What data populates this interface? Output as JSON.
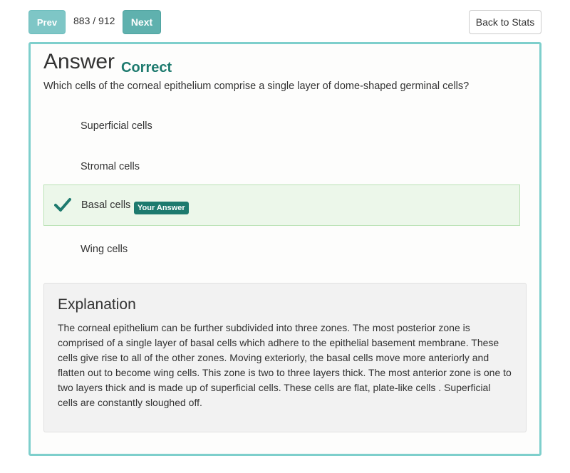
{
  "nav": {
    "prev_label": "Prev",
    "counter": "883 / 912",
    "next_label": "Next",
    "back_label": "Back to Stats"
  },
  "answer": {
    "title": "Answer",
    "status": "Correct",
    "question": "Which cells of the corneal epithelium comprise a single layer of dome-shaped germinal cells?",
    "options": [
      {
        "label": "Superficial cells"
      },
      {
        "label": "Stromal cells"
      },
      {
        "label": "Basal cells",
        "selected": true,
        "badge": "Your Answer",
        "icon": "check-icon"
      },
      {
        "label": "Wing cells"
      }
    ]
  },
  "explanation": {
    "title": "Explanation",
    "body": "The corneal epithelium can be further subdivided into three zones. The most posterior zone is comprised of a single layer of basal cells which adhere to the epithelial basement membrane. These cells give rise to all of the other zones. Moving exteriorly, the basal cells move more anteriorly and flatten out to become wing cells. This zone is two to three layers thick. The most anterior zone is one to two layers thick and is made up of superficial cells. These cells are flat, plate-like cells . Superficial cells are constantly sloughed off."
  },
  "colors": {
    "accent": "#1d7a6e",
    "panel_border": "#7ecfcc",
    "selected_bg": "#ecf7ea"
  }
}
